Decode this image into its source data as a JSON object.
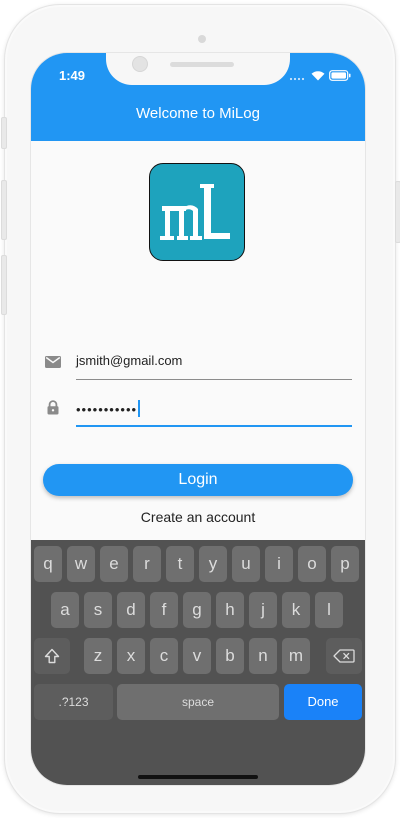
{
  "status_bar": {
    "time": "1:49",
    "icons": [
      "cellular-icon",
      "wifi-icon",
      "battery-icon"
    ]
  },
  "app_bar": {
    "title": "Welcome to MiLog"
  },
  "logo": {
    "text": "mL",
    "color": "#1ea3bd"
  },
  "form": {
    "email": {
      "value": "jsmith@gmail.com",
      "icon": "mail-icon"
    },
    "password": {
      "value": "•••••••••••",
      "icon": "lock-icon"
    }
  },
  "actions": {
    "login_label": "Login",
    "create_account_label": "Create an account"
  },
  "keyboard": {
    "row1": [
      "q",
      "w",
      "e",
      "r",
      "t",
      "y",
      "u",
      "i",
      "o",
      "p"
    ],
    "row2": [
      "a",
      "s",
      "d",
      "f",
      "g",
      "h",
      "j",
      "k",
      "l"
    ],
    "row3": [
      "z",
      "x",
      "c",
      "v",
      "b",
      "n",
      "m"
    ],
    "numbers_label": ".?123",
    "space_label": "space",
    "done_label": "Done"
  },
  "colors": {
    "primary": "#2196f3",
    "done_key": "#1a82f8",
    "keyboard_bg": "#525252"
  }
}
